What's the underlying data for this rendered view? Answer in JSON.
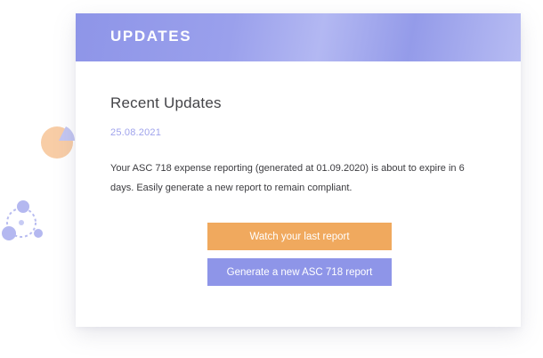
{
  "header": {
    "title": "UPDATES"
  },
  "updates": {
    "section_title": "Recent Updates",
    "date": "25.08.2021",
    "message": "Your ASC 718 expense reporting (generated at 01.09.2020) is about to expire in 6 days. Easily generate a new report to remain compliant."
  },
  "actions": {
    "watch_label": "Watch your last report",
    "generate_label": "Generate a new ASC 718 report"
  },
  "decorations": {
    "left_icons": [
      "pie-chart-icon",
      "network-nodes-icon"
    ]
  },
  "colors": {
    "header_gradient_start": "#8e95e8",
    "accent_orange": "#f0a95e",
    "accent_purple": "#8e95e8",
    "date_color": "#9fa3ec"
  }
}
